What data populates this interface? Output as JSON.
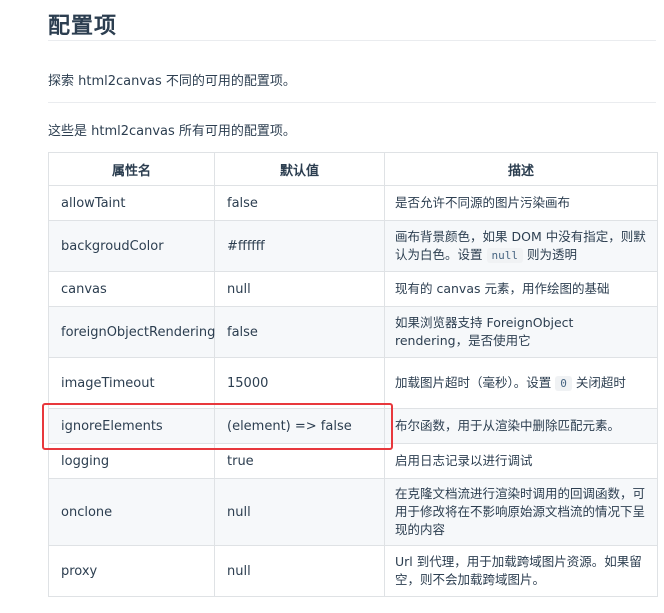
{
  "page": {
    "title": "配置项",
    "intro": "探索 html2canvas 不同的可用的配置项。",
    "lead": "这些是 html2canvas 所有可用的配置项。"
  },
  "table": {
    "headers": [
      "属性名",
      "默认值",
      "描述"
    ],
    "rows": [
      {
        "name": "allowTaint",
        "default": "false",
        "desc_before": "是否允许不同源的图片污染画布"
      },
      {
        "name": "backgroudColor",
        "default": "#ffffff",
        "desc_before": "画布背景颜色，如果 DOM 中没有指定，则默认为白色。设置",
        "code": "null",
        "desc_after": "则为透明"
      },
      {
        "name": "canvas",
        "default": "null",
        "desc_before": "现有的 canvas 元素，用作绘图的基础"
      },
      {
        "name": "foreignObjectRendering",
        "default": "false",
        "desc_before": "如果浏览器支持 ForeignObject rendering，是否使用它"
      },
      {
        "name": "imageTimeout",
        "default": "15000",
        "desc_before": "加载图片超时（毫秒）。设置",
        "code": "0",
        "desc_after": "关闭超时"
      },
      {
        "name": "ignoreElements",
        "default": "(element) => false",
        "desc_before": "布尔函数，用于从渲染中删除匹配元素。"
      },
      {
        "name": "logging",
        "default": "true",
        "desc_before": "启用日志记录以进行调试"
      },
      {
        "name": "onclone",
        "default": "null",
        "desc_before": "在克隆文档流进行渲染时调用的回调函数，可用于修改将在不影响原始源文档流的情况下呈现的内容"
      },
      {
        "name": "proxy",
        "default": "null",
        "desc_before": "Url 到代理，用于加载跨域图片资源。如果留空，则不会加载跨域图片。"
      }
    ]
  },
  "colors": {
    "text": "#2c3e50",
    "border": "#dfe2e5",
    "stripe": "#f6f8fa",
    "highlight": "#e8383d"
  }
}
